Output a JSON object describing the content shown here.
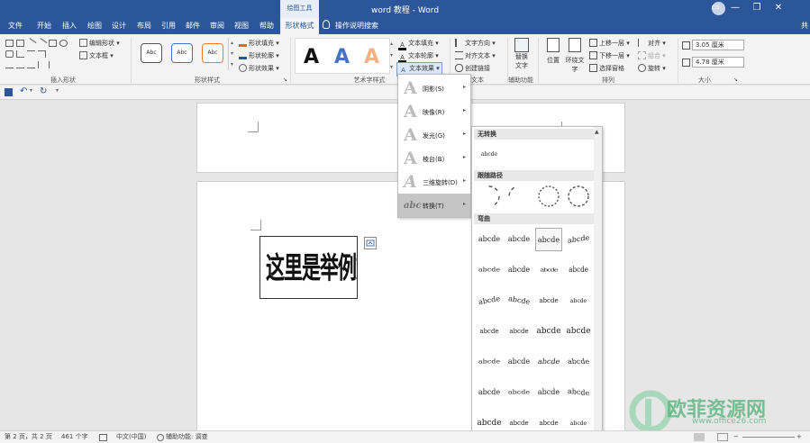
{
  "window": {
    "title": "word 教程 - Word",
    "context_tab": "绘图工具",
    "controls": [
      "—",
      "❐",
      "✕"
    ]
  },
  "tabs": [
    {
      "label": "文件",
      "active": false
    },
    {
      "label": "开始",
      "active": false
    },
    {
      "label": "插入",
      "active": false
    },
    {
      "label": "绘图",
      "active": false
    },
    {
      "label": "设计",
      "active": false
    },
    {
      "label": "布局",
      "active": false
    },
    {
      "label": "引用",
      "active": false
    },
    {
      "label": "邮件",
      "active": false
    },
    {
      "label": "审阅",
      "active": false
    },
    {
      "label": "视图",
      "active": false
    },
    {
      "label": "帮助",
      "active": false
    },
    {
      "label": "形状格式",
      "active": true
    }
  ],
  "tell_me": "操作说明搜索",
  "share": "共",
  "ribbon": {
    "insert_shapes": {
      "edit_shape": "编辑形状",
      "text_box": "文本框",
      "label": "插入形状"
    },
    "shape_styles": {
      "preset": [
        "Abc",
        "Abc",
        "Abc"
      ],
      "fill": "形状填充",
      "outline": "形状轮廓",
      "effects": "形状效果",
      "label": "形状样式"
    },
    "wordart_styles": {
      "glyph": "A",
      "text_fill": "文本填充",
      "text_outline": "文本轮廓",
      "text_effects": "文本效果",
      "label": "艺术字样式"
    },
    "text": {
      "direction": "文字方向",
      "align": "对齐文本",
      "link": "创建链接",
      "label": "文本"
    },
    "accessibility": {
      "alt_text_line1": "替换",
      "alt_text_line2": "文字",
      "label": "辅助功能"
    },
    "arrange": {
      "position": "位置",
      "wrap_line1": "环绕文",
      "wrap_line2": "字",
      "forward": "上移一层",
      "backward": "下移一层",
      "selection_pane": "选择窗格",
      "align": "对齐",
      "group": "组合",
      "rotate": "旋转",
      "label": "排列"
    },
    "size": {
      "height": "3.05 厘米",
      "width": "4.78 厘米",
      "label": "大小"
    }
  },
  "document": {
    "textbox_text": "这里是举例文本内容。"
  },
  "text_effects_menu": [
    {
      "label": "阴影(S)"
    },
    {
      "label": "映像(R)"
    },
    {
      "label": "发光(G)"
    },
    {
      "label": "棱台(B)"
    },
    {
      "label": "三维旋转(D)"
    },
    {
      "label": "转换(T)"
    }
  ],
  "transform_menu": {
    "no_transform_head": "无转换",
    "no_transform_sample": "abcde",
    "follow_path_head": "跟随路径",
    "warp_head": "弯曲",
    "warp_sample": "abcde",
    "warp_selected_row": 0,
    "warp_selected_col": 2,
    "warp_rows": 7,
    "warp_cols": 4
  },
  "statusbar": {
    "page": "第 2 页，共 2 页",
    "words": "461 个字",
    "language": "中文(中国)",
    "accessibility": "辅助功能: 调查"
  },
  "watermark": {
    "cn": "欧菲资源网",
    "url": "www.office26.com"
  },
  "colors": {
    "word_blue": "#2b579a",
    "menu_active": "#c5c5c5",
    "watermark_green": "#6dbf8d"
  }
}
